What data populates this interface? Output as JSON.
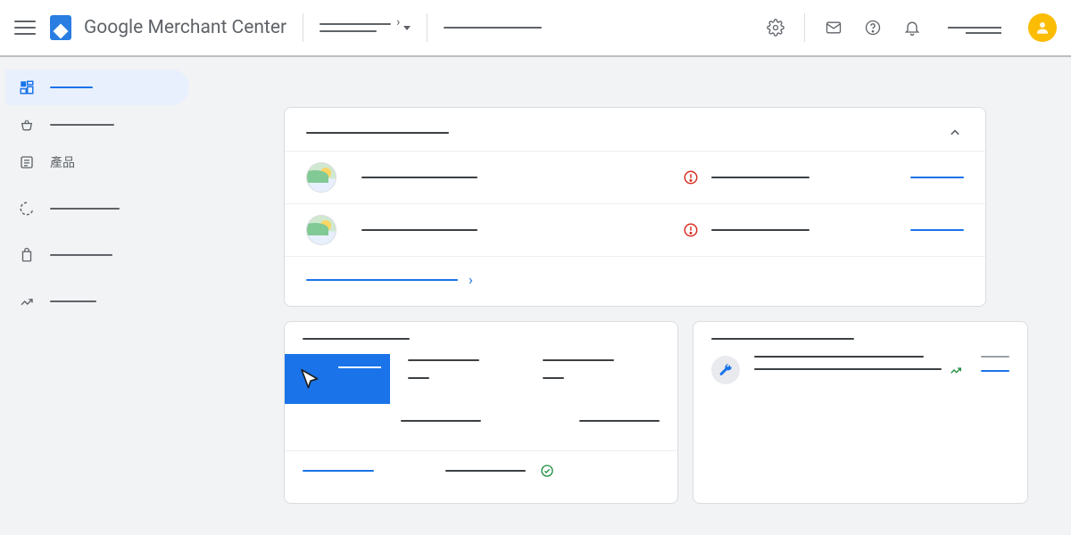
{
  "header": {
    "app_title": "Google Merchant Center",
    "account_selector_label": "",
    "breadcrumb_label": "",
    "account_name": ""
  },
  "sidebar": {
    "items": [
      {
        "id": "overview",
        "label": "",
        "active": true
      },
      {
        "id": "shopping",
        "label": ""
      },
      {
        "id": "products",
        "label": "產品"
      },
      {
        "id": "performance",
        "label": ""
      },
      {
        "id": "marketing",
        "label": ""
      },
      {
        "id": "growth",
        "label": ""
      }
    ]
  },
  "cards": {
    "overview": {
      "title": "",
      "footer_link": "",
      "rows": [
        {
          "name": "",
          "status_text": "",
          "status": "error",
          "action": ""
        },
        {
          "name": "",
          "status_text": "",
          "status": "error",
          "action": ""
        }
      ]
    },
    "left_panel": {
      "title": "",
      "highlight_label": "",
      "metrics": [
        {
          "label": "",
          "value": ""
        },
        {
          "label": "",
          "value": ""
        }
      ],
      "secondary_metrics": [
        {
          "label": "",
          "value": ""
        },
        {
          "label": "",
          "value": ""
        }
      ],
      "bottom_link": "",
      "bottom_status_text": "",
      "bottom_status": "ok"
    },
    "right_panel": {
      "title": "",
      "insight": {
        "line1": "",
        "line2": "",
        "trend": "up",
        "meta": "",
        "action": ""
      }
    }
  },
  "colors": {
    "primary": "#1a73e8",
    "error": "#d93025",
    "success": "#1e8e3e",
    "avatar": "#fbbc04"
  }
}
